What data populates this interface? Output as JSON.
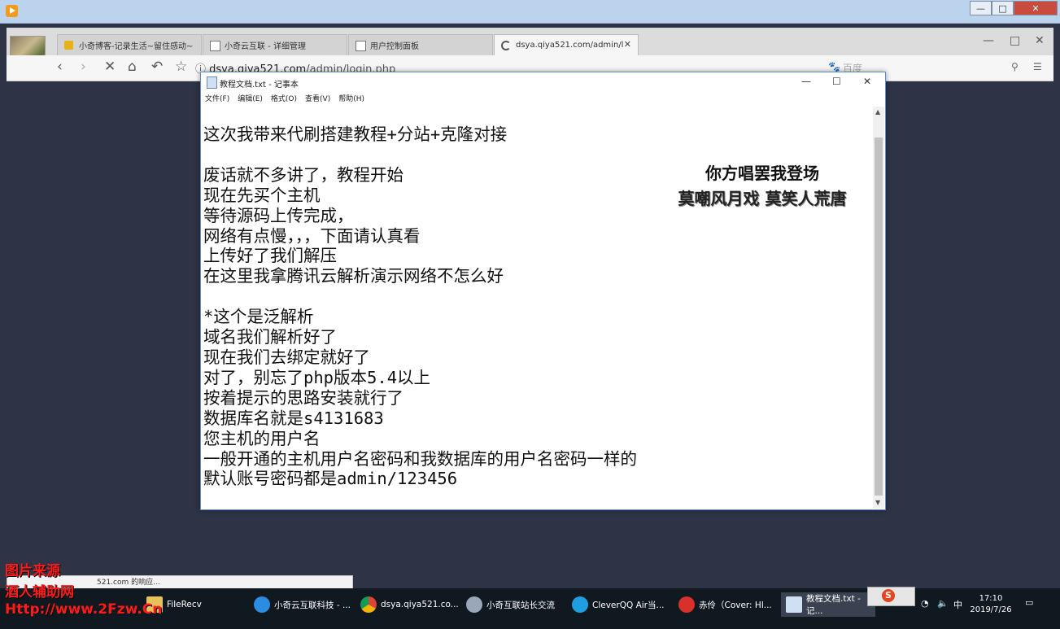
{
  "browser": {
    "tabs": [
      {
        "label": "小奇博客-记录生活~留住感动~"
      },
      {
        "label": "小奇云互联 - 详细管理"
      },
      {
        "label": "用户控制面板"
      },
      {
        "label": "dsya.qiya521.com/admin/l"
      }
    ],
    "url": {
      "host": "dsya.qiya521.com",
      "path": "/admin/login.php"
    },
    "search_hint": "百度"
  },
  "notepad": {
    "title": "教程文档.txt - 记事本",
    "menu": [
      "文件(F)",
      "编辑(E)",
      "格式(O)",
      "查看(V)",
      "帮助(H)"
    ],
    "lines": [
      "这次我带来代刷搭建教程+分站+克隆对接",
      "",
      "废话就不多讲了，教程开始",
      "现在先买个主机",
      "等待源码上传完成，",
      "网络有点慢，，，下面请认真看",
      "上传好了我们解压",
      "在这里我拿腾讯云解析演示网络不怎么好",
      "",
      "*这个是泛解析",
      "域名我们解析好了",
      "现在我们去绑定就好了",
      "对了，别忘了php版本5.4以上",
      "按着提示的思路安装就行了",
      "数据库名就是s4131683",
      "您主机的用户名",
      "一般开通的主机用户名密码和我数据库的用户名密码一样的",
      "默认账号密码都是admin/123456"
    ],
    "overlay_line1": "你方唱罢我登场",
    "overlay_line2": "莫嘲风月戏 莫笑人荒唐"
  },
  "status_popup": "521.com 的响应...",
  "taskbar": {
    "items": [
      {
        "label": "FileRecv"
      },
      {
        "label": "小奇云互联科技 - ..."
      },
      {
        "label": "dsya.qiya521.co..."
      },
      {
        "label": "小奇互联站长交流"
      },
      {
        "label": "CleverQQ Air当..."
      },
      {
        "label": "赤伶（Cover: Hl..."
      },
      {
        "label": "教程文档.txt - 记..."
      }
    ],
    "ime_lang": "中",
    "time": "17:10",
    "date": "2019/7/26"
  },
  "watermark": {
    "line1": "图片来源",
    "line2": "酒人辅助网",
    "line3": "Http://www.2Fzw.Cn"
  },
  "colors": {
    "desktop": "#2e3346",
    "taskbar": "#101820",
    "watermark": "#ff1a1a",
    "notepad_border": "#5b8fd6"
  }
}
